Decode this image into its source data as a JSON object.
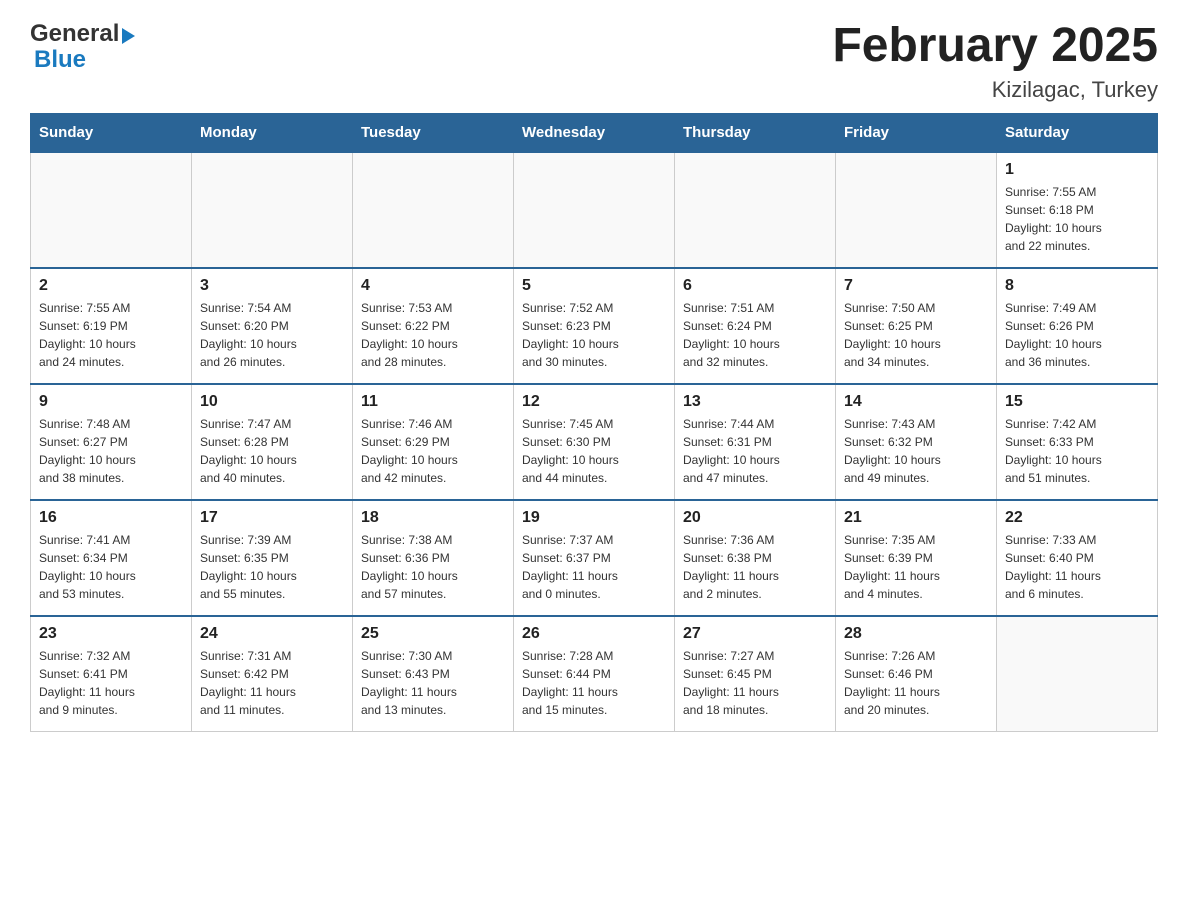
{
  "header": {
    "logo": {
      "general": "General",
      "triangle": "▶",
      "blue": "Blue"
    },
    "title": "February 2025",
    "subtitle": "Kizilagac, Turkey"
  },
  "weekdays": [
    "Sunday",
    "Monday",
    "Tuesday",
    "Wednesday",
    "Thursday",
    "Friday",
    "Saturday"
  ],
  "weeks": [
    [
      {
        "day": "",
        "info": ""
      },
      {
        "day": "",
        "info": ""
      },
      {
        "day": "",
        "info": ""
      },
      {
        "day": "",
        "info": ""
      },
      {
        "day": "",
        "info": ""
      },
      {
        "day": "",
        "info": ""
      },
      {
        "day": "1",
        "info": "Sunrise: 7:55 AM\nSunset: 6:18 PM\nDaylight: 10 hours\nand 22 minutes."
      }
    ],
    [
      {
        "day": "2",
        "info": "Sunrise: 7:55 AM\nSunset: 6:19 PM\nDaylight: 10 hours\nand 24 minutes."
      },
      {
        "day": "3",
        "info": "Sunrise: 7:54 AM\nSunset: 6:20 PM\nDaylight: 10 hours\nand 26 minutes."
      },
      {
        "day": "4",
        "info": "Sunrise: 7:53 AM\nSunset: 6:22 PM\nDaylight: 10 hours\nand 28 minutes."
      },
      {
        "day": "5",
        "info": "Sunrise: 7:52 AM\nSunset: 6:23 PM\nDaylight: 10 hours\nand 30 minutes."
      },
      {
        "day": "6",
        "info": "Sunrise: 7:51 AM\nSunset: 6:24 PM\nDaylight: 10 hours\nand 32 minutes."
      },
      {
        "day": "7",
        "info": "Sunrise: 7:50 AM\nSunset: 6:25 PM\nDaylight: 10 hours\nand 34 minutes."
      },
      {
        "day": "8",
        "info": "Sunrise: 7:49 AM\nSunset: 6:26 PM\nDaylight: 10 hours\nand 36 minutes."
      }
    ],
    [
      {
        "day": "9",
        "info": "Sunrise: 7:48 AM\nSunset: 6:27 PM\nDaylight: 10 hours\nand 38 minutes."
      },
      {
        "day": "10",
        "info": "Sunrise: 7:47 AM\nSunset: 6:28 PM\nDaylight: 10 hours\nand 40 minutes."
      },
      {
        "day": "11",
        "info": "Sunrise: 7:46 AM\nSunset: 6:29 PM\nDaylight: 10 hours\nand 42 minutes."
      },
      {
        "day": "12",
        "info": "Sunrise: 7:45 AM\nSunset: 6:30 PM\nDaylight: 10 hours\nand 44 minutes."
      },
      {
        "day": "13",
        "info": "Sunrise: 7:44 AM\nSunset: 6:31 PM\nDaylight: 10 hours\nand 47 minutes."
      },
      {
        "day": "14",
        "info": "Sunrise: 7:43 AM\nSunset: 6:32 PM\nDaylight: 10 hours\nand 49 minutes."
      },
      {
        "day": "15",
        "info": "Sunrise: 7:42 AM\nSunset: 6:33 PM\nDaylight: 10 hours\nand 51 minutes."
      }
    ],
    [
      {
        "day": "16",
        "info": "Sunrise: 7:41 AM\nSunset: 6:34 PM\nDaylight: 10 hours\nand 53 minutes."
      },
      {
        "day": "17",
        "info": "Sunrise: 7:39 AM\nSunset: 6:35 PM\nDaylight: 10 hours\nand 55 minutes."
      },
      {
        "day": "18",
        "info": "Sunrise: 7:38 AM\nSunset: 6:36 PM\nDaylight: 10 hours\nand 57 minutes."
      },
      {
        "day": "19",
        "info": "Sunrise: 7:37 AM\nSunset: 6:37 PM\nDaylight: 11 hours\nand 0 minutes."
      },
      {
        "day": "20",
        "info": "Sunrise: 7:36 AM\nSunset: 6:38 PM\nDaylight: 11 hours\nand 2 minutes."
      },
      {
        "day": "21",
        "info": "Sunrise: 7:35 AM\nSunset: 6:39 PM\nDaylight: 11 hours\nand 4 minutes."
      },
      {
        "day": "22",
        "info": "Sunrise: 7:33 AM\nSunset: 6:40 PM\nDaylight: 11 hours\nand 6 minutes."
      }
    ],
    [
      {
        "day": "23",
        "info": "Sunrise: 7:32 AM\nSunset: 6:41 PM\nDaylight: 11 hours\nand 9 minutes."
      },
      {
        "day": "24",
        "info": "Sunrise: 7:31 AM\nSunset: 6:42 PM\nDaylight: 11 hours\nand 11 minutes."
      },
      {
        "day": "25",
        "info": "Sunrise: 7:30 AM\nSunset: 6:43 PM\nDaylight: 11 hours\nand 13 minutes."
      },
      {
        "day": "26",
        "info": "Sunrise: 7:28 AM\nSunset: 6:44 PM\nDaylight: 11 hours\nand 15 minutes."
      },
      {
        "day": "27",
        "info": "Sunrise: 7:27 AM\nSunset: 6:45 PM\nDaylight: 11 hours\nand 18 minutes."
      },
      {
        "day": "28",
        "info": "Sunrise: 7:26 AM\nSunset: 6:46 PM\nDaylight: 11 hours\nand 20 minutes."
      },
      {
        "day": "",
        "info": ""
      }
    ]
  ]
}
